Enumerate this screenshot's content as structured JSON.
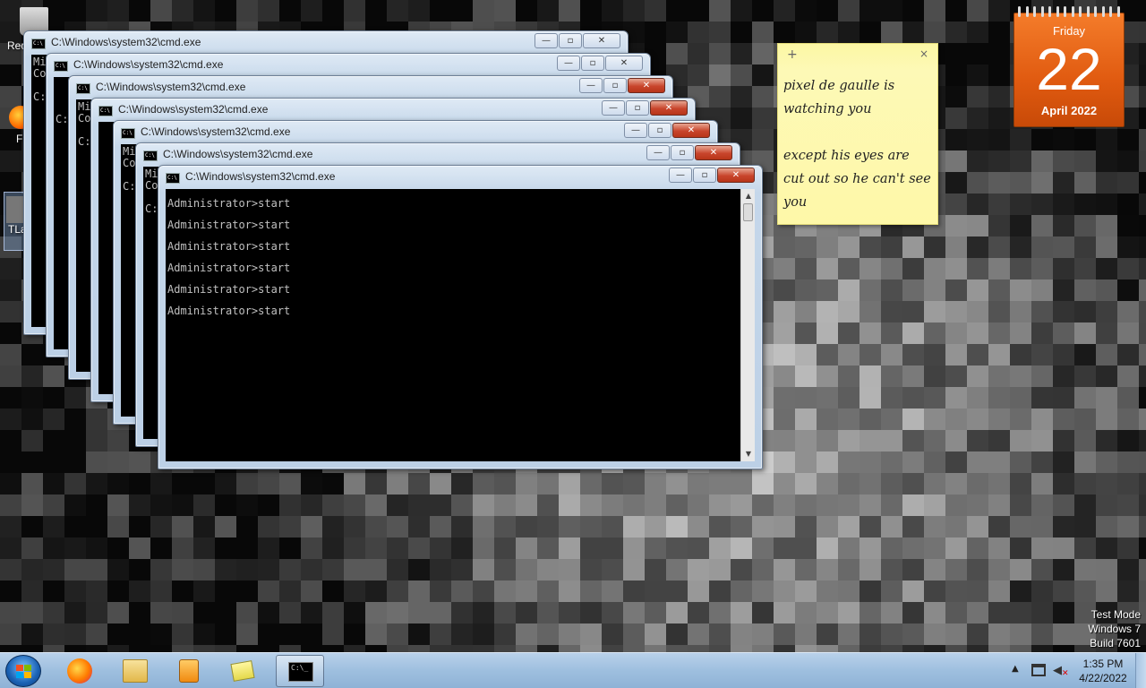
{
  "desktop": {
    "icons": [
      {
        "label": "Rec",
        "icon": "recycle-bin-icon"
      },
      {
        "label": "F",
        "icon": "firefox-icon"
      },
      {
        "label": "TLa",
        "icon": "shortcut-icon"
      }
    ]
  },
  "cmd_windows": [
    {
      "title": "C:\\Windows\\system32\\cmd.exe",
      "preview": [
        "Mi",
        "Co",
        "",
        "C:"
      ]
    },
    {
      "title": "C:\\Windows\\system32\\cmd.exe",
      "preview": [
        "",
        "",
        "",
        "C:"
      ]
    },
    {
      "title": "C:\\Windows\\system32\\cmd.exe",
      "preview": [
        "Mi",
        "Co",
        "",
        "C:"
      ]
    },
    {
      "title": "C:\\Windows\\system32\\cmd.exe",
      "preview": [
        "",
        "",
        "",
        ""
      ]
    },
    {
      "title": "C:\\Windows\\system32\\cmd.exe",
      "preview": [
        "Mi",
        "Co",
        "",
        "C:"
      ]
    },
    {
      "title": "C:\\Windows\\system32\\cmd.exe",
      "preview": [
        "Mi",
        "Co",
        "",
        "C:"
      ]
    },
    {
      "title": "C:\\Windows\\system32\\cmd.exe",
      "lines": [
        "Administrator>start",
        "Administrator>start",
        "Administrator>start",
        "Administrator>start",
        "Administrator>start",
        "Administrator>start"
      ]
    }
  ],
  "sticky_note": {
    "text": "pixel de gaulle is\nwatching you\n\nexcept his eyes are\ncut out so he can't see\nyou",
    "add_glyph": "+",
    "close_glyph": "×"
  },
  "calendar": {
    "weekday": "Friday",
    "day": "22",
    "month_year": "April 2022"
  },
  "watermark": {
    "line1": "Test Mode",
    "line2": "Windows 7",
    "line3": "Build 7601"
  },
  "taskbar": {
    "pinned": [
      "firefox-icon",
      "explorer-folder-icon",
      "media-player-icon",
      "sticky-notes-icon",
      "cmd-icon"
    ],
    "tray": {
      "show_hidden": "▲",
      "time": "1:35 PM",
      "date": "4/22/2022"
    }
  },
  "colors": {
    "taskbar": "#9ebfdf",
    "sticky": "#fdf9b6",
    "calendar": "#e05a10",
    "close_button": "#c8452c"
  }
}
